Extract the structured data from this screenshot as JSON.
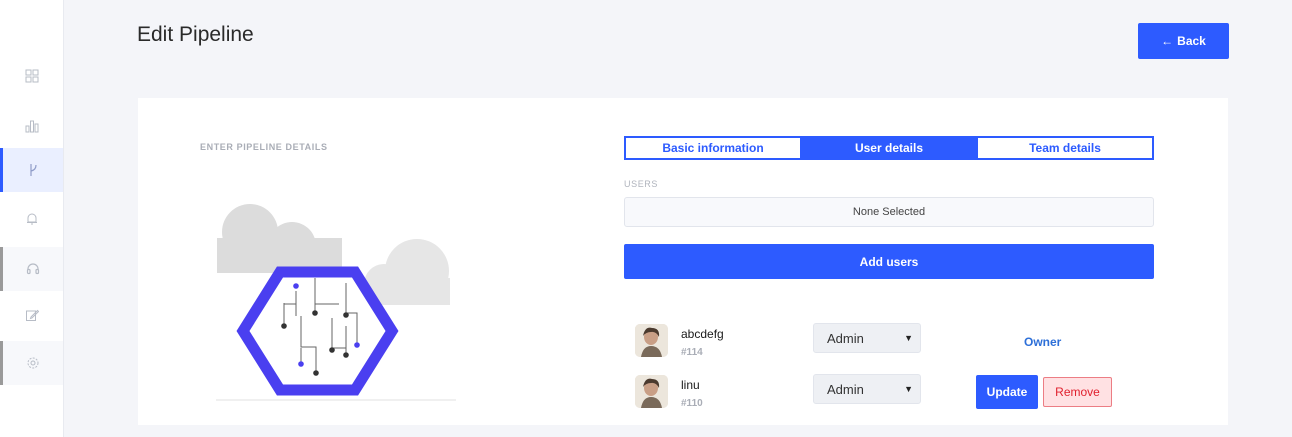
{
  "sidebar": {
    "items": [
      {
        "icon": "dashboard-icon"
      },
      {
        "icon": "bar-chart-icon"
      },
      {
        "icon": "pipeline-branch-icon"
      },
      {
        "icon": "bell-icon"
      },
      {
        "icon": "headset-icon"
      },
      {
        "icon": "edit-icon"
      },
      {
        "icon": "settings-icon"
      }
    ]
  },
  "header": {
    "title": "Edit Pipeline",
    "back_label": "Back"
  },
  "card": {
    "section_label": "ENTER PIPELINE DETAILS",
    "tabs": [
      {
        "label": "Basic information",
        "active": false
      },
      {
        "label": "User details",
        "active": true
      },
      {
        "label": "Team details",
        "active": false
      }
    ],
    "users_label": "USERS",
    "users_select_value": "None Selected",
    "add_users_label": "Add users",
    "users": [
      {
        "name": "abcdefg",
        "id": "#114",
        "role": "Admin",
        "status": "Owner"
      },
      {
        "name": "linu",
        "id": "#110",
        "role": "Admin",
        "update_label": "Update",
        "remove_label": "Remove"
      }
    ]
  },
  "colors": {
    "accent": "#2d5bff",
    "illustration_hex": "#4a3ff0",
    "remove_text": "#e0202e",
    "remove_bg": "#ffe1e3"
  }
}
